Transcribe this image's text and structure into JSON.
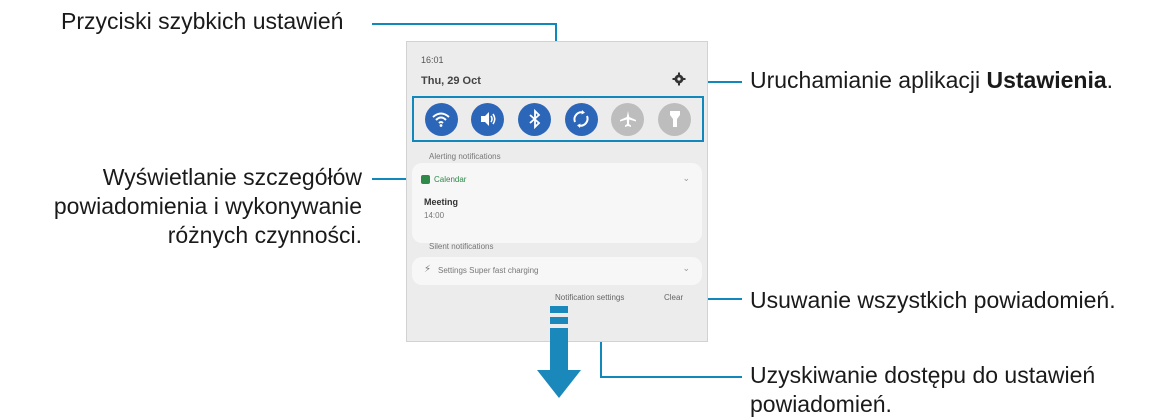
{
  "callouts": {
    "quick_settings": "Przyciski szybkich ustawień",
    "settings_prefix": "Uruchamianie aplikacji ",
    "settings_bold": "Ustawienia",
    "settings_suffix": ".",
    "details_line1": "Wyświetlanie szczegółów",
    "details_line2": "powiadomienia i wykonywanie",
    "details_line3": "różnych czynności.",
    "clear_all": "Usuwanie wszystkich powiadomień.",
    "notif_settings_line1": "Uzyskiwanie dostępu do ustawień",
    "notif_settings_line2": "powiadomień."
  },
  "panel": {
    "time": "16:01",
    "date": "Thu, 29 Oct",
    "quick_buttons": [
      {
        "icon": "wifi-icon",
        "state": "on"
      },
      {
        "icon": "sound-icon",
        "state": "on"
      },
      {
        "icon": "bluetooth-icon",
        "state": "on"
      },
      {
        "icon": "auto-rotate-icon",
        "state": "on"
      },
      {
        "icon": "airplane-icon",
        "state": "off"
      },
      {
        "icon": "flashlight-icon",
        "state": "off"
      }
    ],
    "alerting_header": "Alerting notifications",
    "calendar_app": "Calendar",
    "event_title": "Meeting",
    "event_time": "14:00",
    "silent_header": "Silent notifications",
    "silent_item": "Settings  Super fast charging",
    "notification_settings_btn": "Notification settings",
    "clear_btn": "Clear"
  },
  "colors": {
    "accent_line": "#1188bb",
    "button_on": "#2c66b8",
    "button_off": "#bdbdbd",
    "arrow": "#1a88bb"
  }
}
